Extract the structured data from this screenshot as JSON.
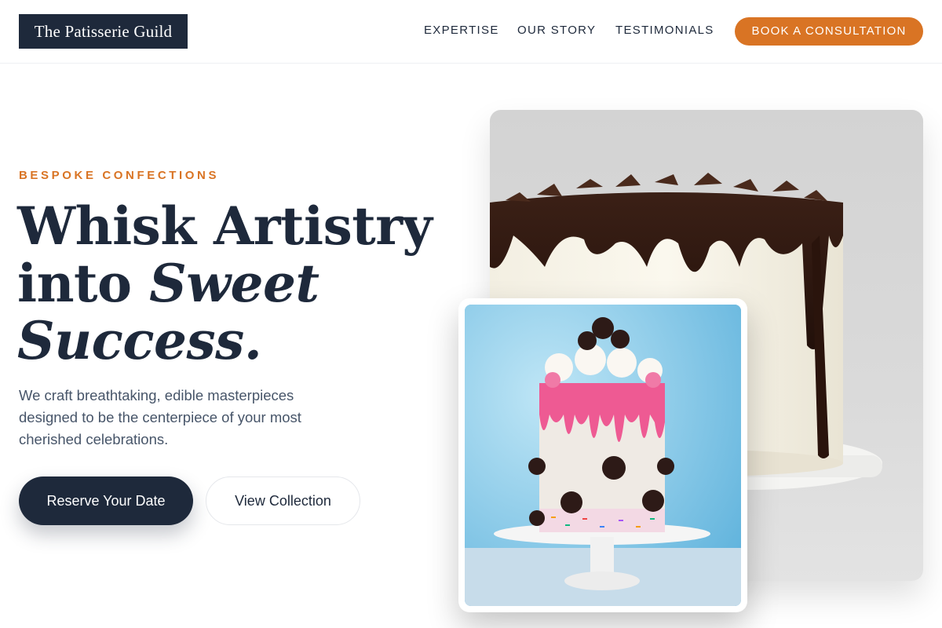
{
  "brand": {
    "name": "The Patisserie Guild"
  },
  "nav": {
    "items": [
      "EXPERTISE",
      "OUR STORY",
      "TESTIMONIALS"
    ],
    "cta": "BOOK A CONSULTATION"
  },
  "hero": {
    "eyebrow": "BESPOKE CONFECTIONS",
    "headline": {
      "line1": "Whisk Artistry",
      "line2_plain": "into",
      "line2_italic": "Sweet",
      "line3_italic": "Success."
    },
    "description": "We craft breathtaking, edible masterpieces designed to be the centerpiece of your most cherished celebrations.",
    "primary_button": "Reserve Your Date",
    "secondary_button": "View Collection"
  },
  "images": {
    "main": "chocolate-drip-cake-photo",
    "inset": "cookies-and-cream-drip-cake-photo"
  },
  "colors": {
    "navy": "#1e293b",
    "accent": "#d97424",
    "body_text": "#475569"
  }
}
